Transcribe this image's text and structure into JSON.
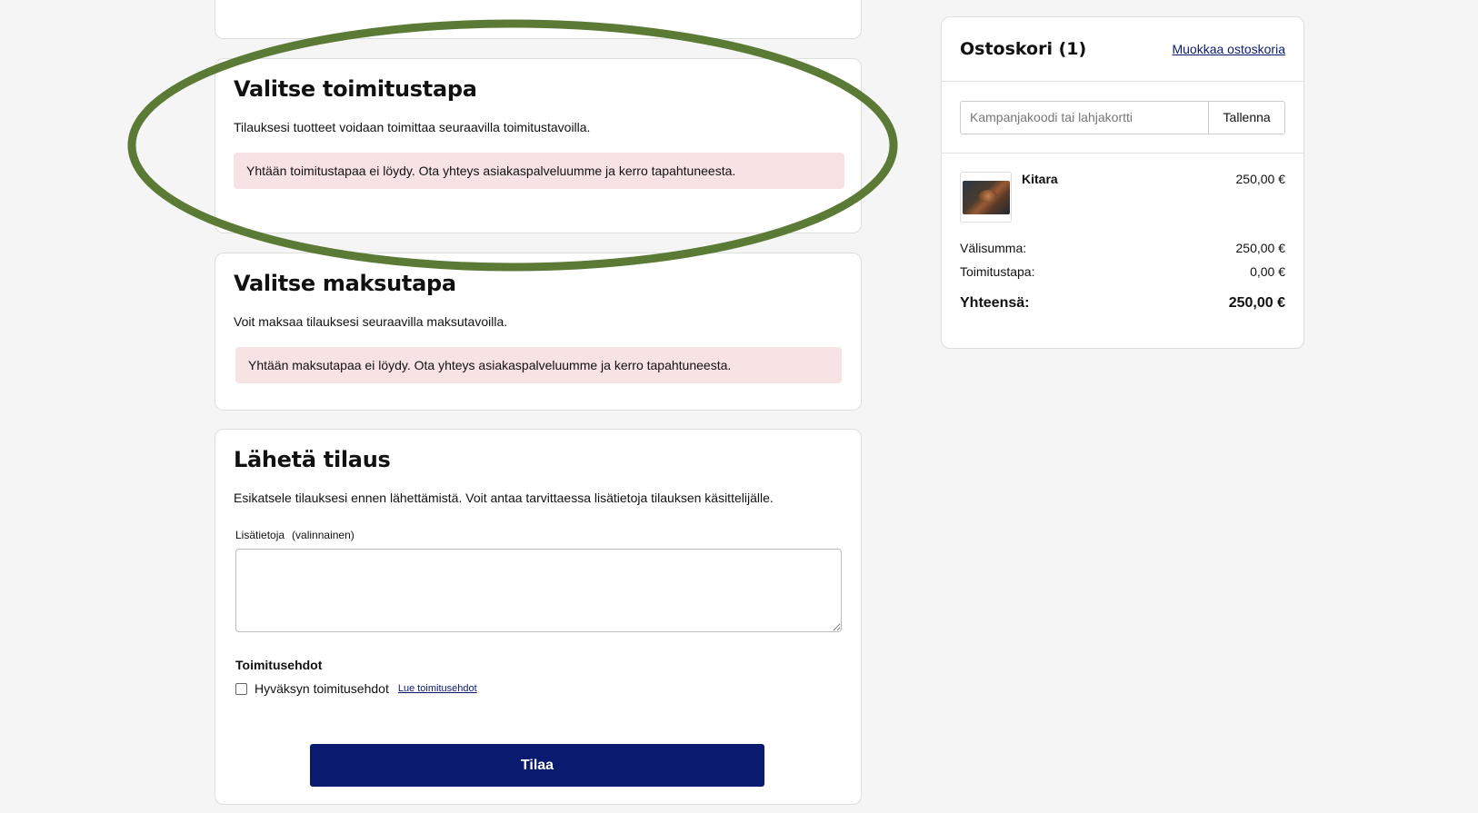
{
  "shipping": {
    "title": "Valitse toimitustapa",
    "description": "Tilauksesi tuotteet voidaan toimittaa seuraavilla toimitustavoilla.",
    "alert": "Yhtään toimitustapaa ei löydy. Ota yhteys asiakaspalveluumme ja kerro tapahtuneesta."
  },
  "payment": {
    "title": "Valitse maksutapa",
    "description": "Voit maksaa tilauksesi seuraavilla maksutavoilla.",
    "alert": "Yhtään maksutapaa ei löydy. Ota yhteys asiakaspalveluumme ja kerro tapahtuneesta."
  },
  "send": {
    "title": "Lähetä tilaus",
    "description": "Esikatsele tilauksesi ennen lähettämistä. Voit antaa tarvittaessa lisätietoja tilauksen käsittelijälle.",
    "notes_label": "Lisätietoja",
    "notes_optional": "(valinnainen)",
    "notes_value": "",
    "terms_title": "Toimitusehdot",
    "terms_checkbox_label": "Hyväksyn toimitusehdot",
    "terms_checked": false,
    "terms_link": "Lue toimitusehdot",
    "submit_label": "Tilaa"
  },
  "cart": {
    "title": "Ostoskori (1)",
    "edit_link": "Muokkaa ostoskoria",
    "coupon_placeholder": "Kampanjakoodi tai lahjakortti",
    "coupon_value": "",
    "coupon_button": "Tallenna",
    "items": [
      {
        "name": "Kitara",
        "price": "250,00 €",
        "image_icon": "guitar-photo"
      }
    ],
    "subtotal_label": "Välisumma:",
    "subtotal_value": "250,00 €",
    "shipping_label": "Toimitustapa:",
    "shipping_value": "0,00 €",
    "total_label": "Yhteensä:",
    "total_value": "250,00 €"
  },
  "colors": {
    "primary_button": "#0a1a6e",
    "alert_background": "#f8e3e4",
    "annotation_ellipse": "#5a7a35",
    "page_background": "#f5f5f5"
  }
}
